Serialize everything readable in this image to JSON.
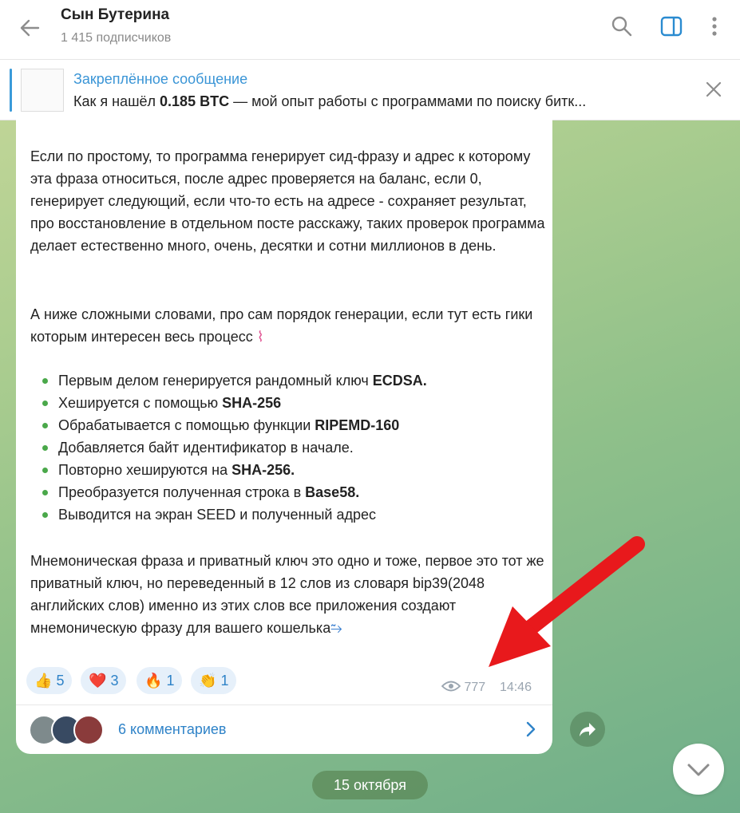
{
  "header": {
    "title": "Сын Бутерина",
    "subtitle": "1 415 подписчиков"
  },
  "pinned": {
    "title": "Закреплённое сообщение",
    "text_prefix": "Как я нашёл ",
    "text_bold": "0.185 BTC",
    "text_suffix": " — мой опыт работы с программами по поиску битк..."
  },
  "message": {
    "paragraph1": "Если по простому, то программа генерирует сид-фразу и адрес к которому эта фраза относиться, после адрес проверяется на баланс, если 0, генерирует следующий, если что-то есть на адресе - сохраняет результат, про восстановление в отдельном посте расскажу, таких проверок программа делает естественно много, очень, десятки и сотни миллионов в день.",
    "paragraph2": "А ниже сложными словами, про сам порядок генерации, если тут есть гики которым интересен весь процесс",
    "list": [
      {
        "text": "Первым делом генерируется рандомный ключ ",
        "bold": "ECDSA."
      },
      {
        "text": "Хешируется с помощью ",
        "bold": "SHA-256"
      },
      {
        "text": "Обрабатывается с помощью функции ",
        "bold": "RIPEMD-160"
      },
      {
        "text": "Добавляется байт идентификатор в начале.",
        "bold": ""
      },
      {
        "text": "Повторно хешируются на ",
        "bold": "SHA-256."
      },
      {
        "text": "Преобразуется полученная строка в ",
        "bold": "Base58."
      },
      {
        "text": "Выводится на экран SEED и полученный адрес",
        "bold": ""
      }
    ],
    "paragraph3": "Мнемоническая фраза и приватный ключ это одно и тоже, первое это тот же приватный ключ, но переведенный в 12 слов из словаря bip39(2048 английских слов) именно из этих слов все приложения создают мнемоническую фразу для вашего кошелька",
    "reactions": [
      {
        "emoji": "👍",
        "count": "5"
      },
      {
        "emoji": "❤️",
        "count": "3"
      },
      {
        "emoji": "🔥",
        "count": "1"
      },
      {
        "emoji": "👏",
        "count": "1"
      }
    ],
    "views": "777",
    "time": "14:46",
    "comments": "6 комментариев"
  },
  "date_separator": "15 октября",
  "colors": {
    "accent": "#3a95d6",
    "bullet": "#4aa84a",
    "arrow": "#e8191c"
  }
}
